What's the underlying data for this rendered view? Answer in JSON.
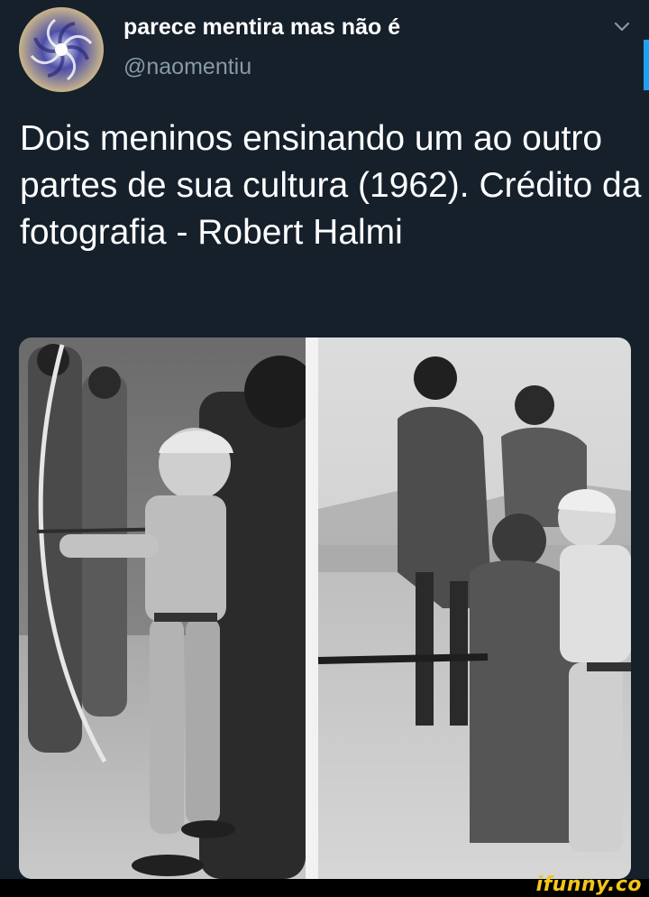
{
  "user": {
    "display_name": "parece mentira mas não é",
    "handle": "@naomentiu"
  },
  "tweet": {
    "text": "Dois meninos ensinando um ao outro partes de sua cultura (1962). Crédito da fotografia - Robert Halmi"
  },
  "icons": {
    "menu": "chevron-down-icon"
  },
  "colors": {
    "background": "#15202b",
    "secondary_text": "#8899a6",
    "accent": "#1da1f2",
    "watermark": "#f5c518"
  },
  "watermark": "ifunny.co"
}
